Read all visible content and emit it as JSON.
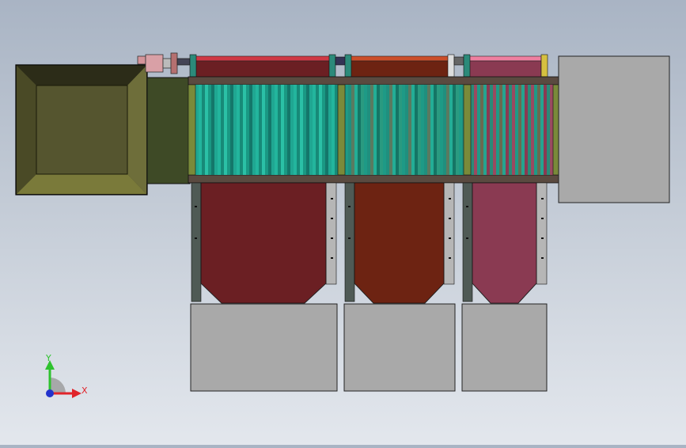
{
  "triad": {
    "x_label": "X",
    "y_label": "Y",
    "x_color": "#e0242a",
    "y_color": "#2ec22e",
    "z_color": "#2233cc"
  },
  "colors": {
    "hopper_frame": "#4a4a26",
    "hopper_inner": "#55552f",
    "hopper_outer_bevel": "#6e6e3a",
    "chute": "#3e4a26",
    "roller_teal": "#1fa792",
    "frame_dark": "#5a4a40",
    "side_rail": "#7a8a3a",
    "bin_1": "#6b1f23",
    "bin_2": "#6d2312",
    "bin_3": "#8a3a52",
    "drive_1": "#c0303a",
    "drive_2": "#c04020",
    "drive_3": "#e07090",
    "table_grey": "#a9a9a9",
    "motor_pink": "#d4949a"
  },
  "icons": {
    "view_triad": "xyz-triad-icon"
  }
}
